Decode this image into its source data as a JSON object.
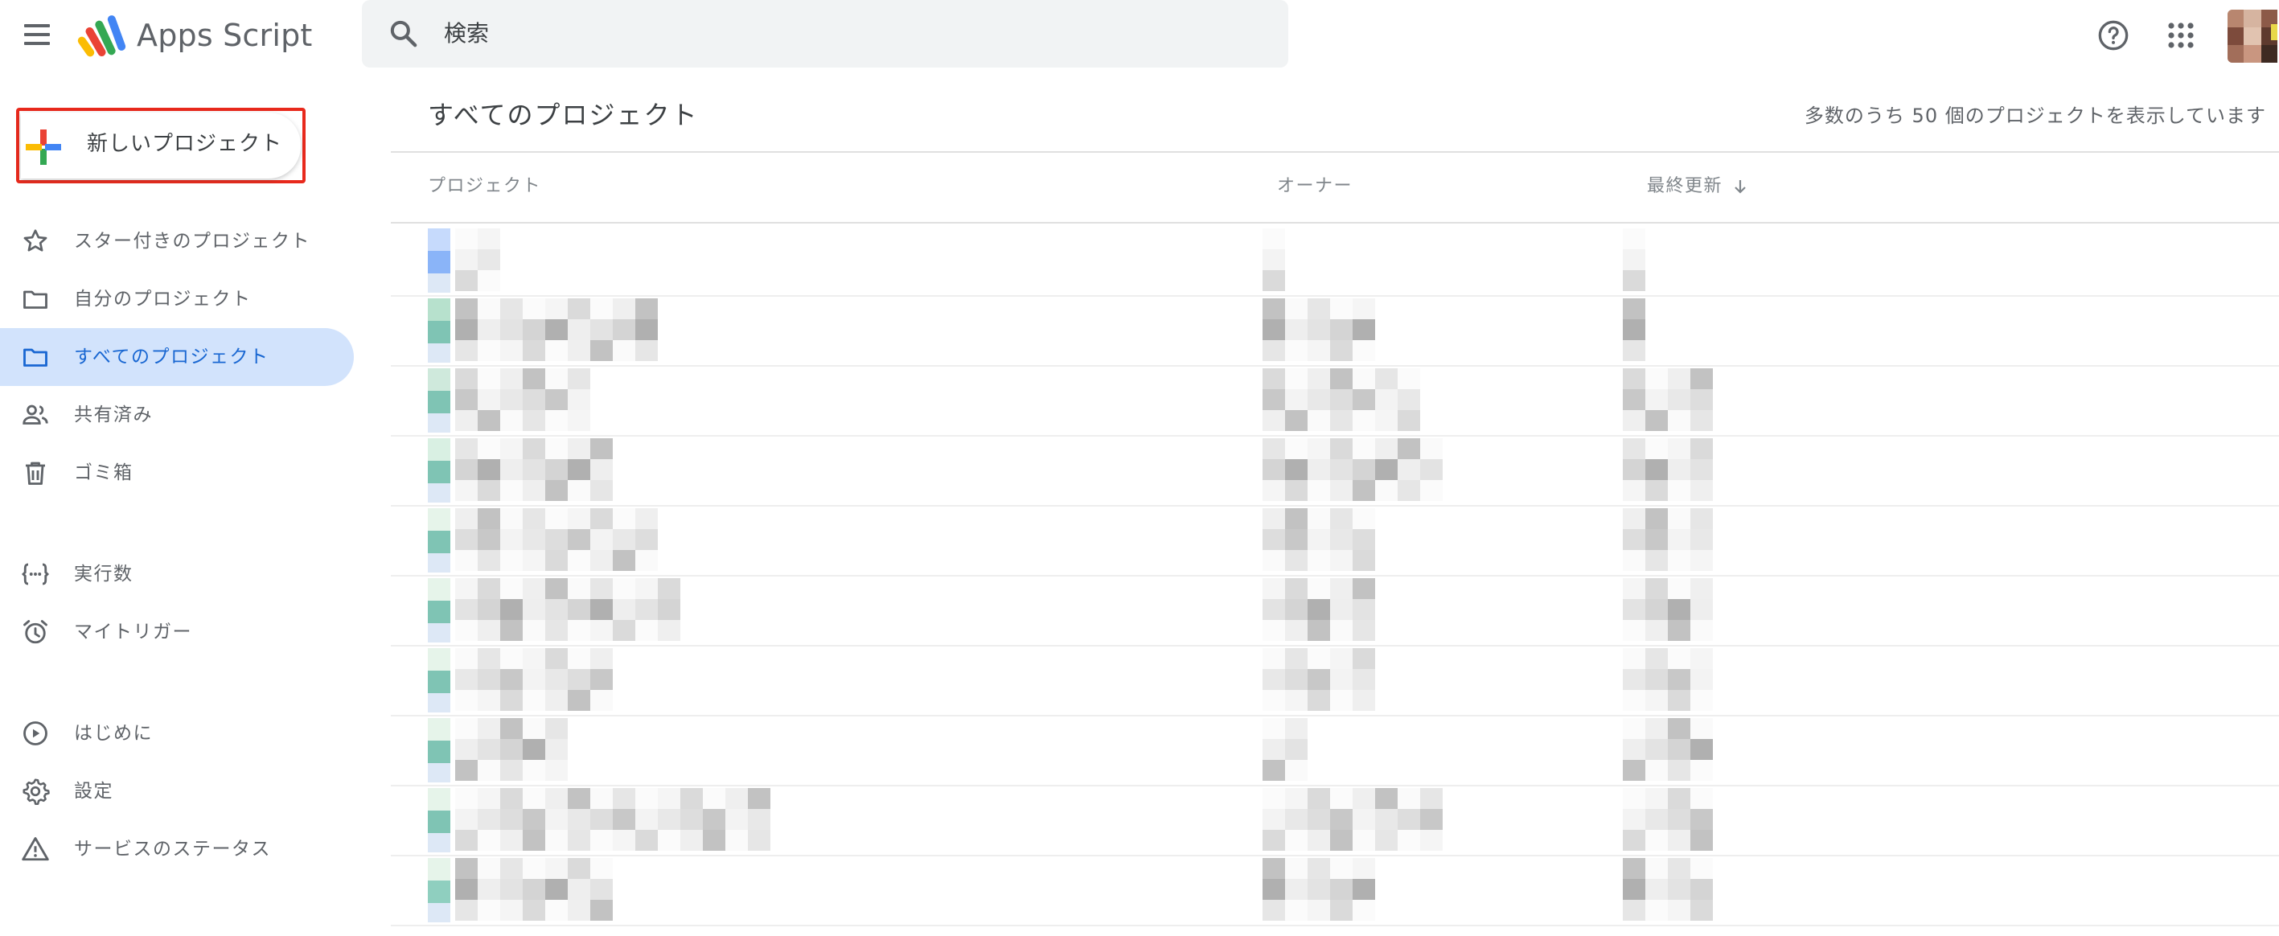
{
  "header": {
    "app_name": "Apps Script",
    "search_placeholder": "検索",
    "icons": {
      "menu": "hamburger-menu-icon",
      "search": "search-icon",
      "help": "help-icon",
      "apps": "apps-grid-icon"
    }
  },
  "sidebar": {
    "new_project_label": "新しいプロジェクト",
    "nav_groups": [
      [
        {
          "label": "スター付きのプロジェクト",
          "icon": "star-icon",
          "active": false
        },
        {
          "label": "自分のプロジェクト",
          "icon": "folder-icon",
          "active": false
        },
        {
          "label": "すべてのプロジェクト",
          "icon": "folder-icon",
          "active": true
        },
        {
          "label": "共有済み",
          "icon": "people-icon",
          "active": false
        },
        {
          "label": "ゴミ箱",
          "icon": "trash-icon",
          "active": false
        }
      ],
      [
        {
          "label": "実行数",
          "icon": "executions-icon",
          "active": false
        },
        {
          "label": "マイトリガー",
          "icon": "alarm-icon",
          "active": false
        }
      ],
      [
        {
          "label": "はじめに",
          "icon": "play-circle-icon",
          "active": false
        },
        {
          "label": "設定",
          "icon": "gear-icon",
          "active": false
        },
        {
          "label": "サービスのステータス",
          "icon": "warning-icon",
          "active": false
        }
      ]
    ]
  },
  "main": {
    "title": "すべてのプロジェクト",
    "count_text": "多数のうち 50 個のプロジェクトを表示しています",
    "columns": {
      "project": "プロジェクト",
      "owner": "オーナー",
      "updated": "最終更新"
    },
    "rows_count_visible": 10
  },
  "colors": {
    "accent": "#1967d2",
    "active_bg": "#d2e3fc",
    "highlight_border": "#e8291c"
  }
}
